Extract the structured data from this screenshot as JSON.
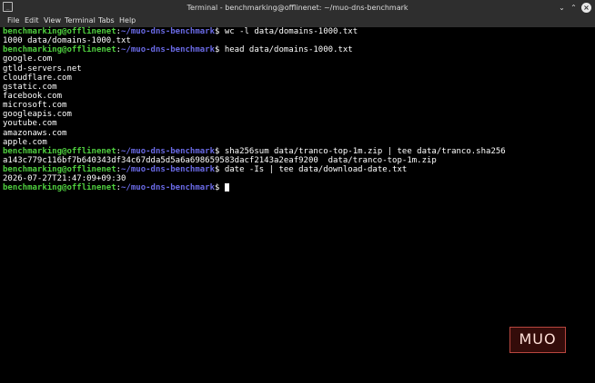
{
  "window": {
    "title": "Terminal - benchmarking@offlinenet: ~/muo-dns-benchmark",
    "app_icon_glyph": "_",
    "min_glyph": "⌄",
    "max_glyph": "⌃",
    "close_glyph": "×"
  },
  "menu": [
    "File",
    "Edit",
    "View",
    "Terminal",
    "Tabs",
    "Help"
  ],
  "prompt": {
    "user_host": "benchmarking@offlinenet",
    "colon": ":",
    "path": "~/muo-dns-benchmark",
    "symbol": "$ "
  },
  "lines": [
    {
      "kind": "prompt",
      "cmd": "wc -l data/domains-1000.txt"
    },
    {
      "kind": "out",
      "text": "1000 data/domains-1000.txt"
    },
    {
      "kind": "prompt",
      "cmd": "head data/domains-1000.txt"
    },
    {
      "kind": "out",
      "text": "google.com"
    },
    {
      "kind": "out",
      "text": "gtld-servers.net"
    },
    {
      "kind": "out",
      "text": "cloudflare.com"
    },
    {
      "kind": "out",
      "text": "gstatic.com"
    },
    {
      "kind": "out",
      "text": "facebook.com"
    },
    {
      "kind": "out",
      "text": "microsoft.com"
    },
    {
      "kind": "out",
      "text": "googleapis.com"
    },
    {
      "kind": "out",
      "text": "youtube.com"
    },
    {
      "kind": "out",
      "text": "amazonaws.com"
    },
    {
      "kind": "out",
      "text": "apple.com"
    },
    {
      "kind": "prompt",
      "cmd": "sha256sum data/tranco-top-1m.zip | tee data/tranco.sha256"
    },
    {
      "kind": "out",
      "text": "a143c779c116bf7b640343df34c67dda5d5a6a698659583dacf2143a2eaf9200  data/tranco-top-1m.zip"
    },
    {
      "kind": "prompt",
      "cmd": "date -Is | tee data/download-date.txt"
    },
    {
      "kind": "out",
      "text": "2026-07-27T21:47:09+09:30"
    },
    {
      "kind": "prompt",
      "cmd": "",
      "cursor": true
    }
  ],
  "watermark": {
    "text": "MUO"
  },
  "colors": {
    "user": "#4fcf3f",
    "path": "#6a6ae6",
    "background": "#000000",
    "text": "#ffffff"
  }
}
